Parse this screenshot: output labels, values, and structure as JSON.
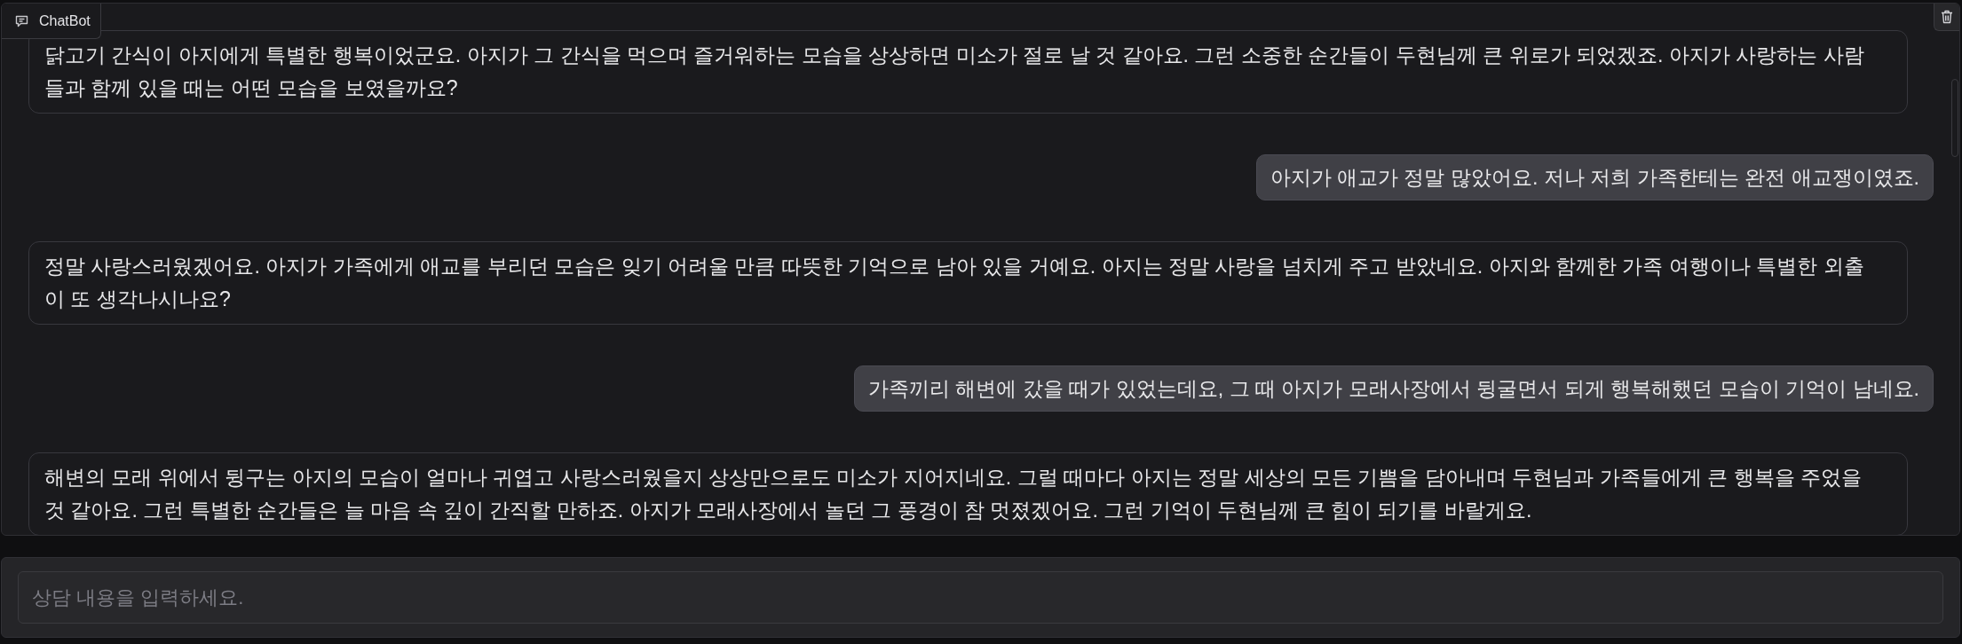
{
  "panel": {
    "label": "ChatBot"
  },
  "messages": [
    {
      "kind": "bot",
      "text": "닭고기 간식이 아지에게 특별한 행복이었군요. 아지가 그 간식을 먹으며 즐거워하는 모습을 상상하면 미소가 절로 날 것 같아요. 그런 소중한 순간들이 두현님께 큰 위로가 되었겠죠. 아지가 사랑하는 사람들과 함께 있을 때는 어떤 모습을 보였을까요?"
    },
    {
      "kind": "user",
      "text": "아지가 애교가 정말 많았어요. 저나 저희 가족한테는 완전 애교쟁이였죠."
    },
    {
      "kind": "bot",
      "text": "정말 사랑스러웠겠어요. 아지가 가족에게 애교를 부리던 모습은 잊기 어려울 만큼 따뜻한 기억으로 남아 있을 거예요. 아지는 정말 사랑을 넘치게 주고 받았네요. 아지와 함께한 가족 여행이나 특별한 외출이 또 생각나시나요?"
    },
    {
      "kind": "user",
      "text": "가족끼리 해변에 갔을 때가 있었는데요, 그 때 아지가 모래사장에서 뒹굴면서 되게 행복해했던 모습이 기억이 남네요."
    },
    {
      "kind": "bot",
      "text": "해변의 모래 위에서 뒹구는 아지의 모습이 얼마나 귀엽고 사랑스러웠을지 상상만으로도 미소가 지어지네요. 그럴 때마다 아지는 정말 세상의 모든 기쁨을 담아내며 두현님과 가족들에게 큰 행복을 주었을 것 같아요. 그런 특별한 순간들은 늘 마음 속 깊이 간직할 만하죠. 아지가 모래사장에서 놀던 그 풍경이 참 멋졌겠어요. 그런 기억이 두현님께 큰 힘이 되기를 바랄게요."
    }
  ],
  "input": {
    "placeholder": "상담 내용을 입력하세요."
  }
}
